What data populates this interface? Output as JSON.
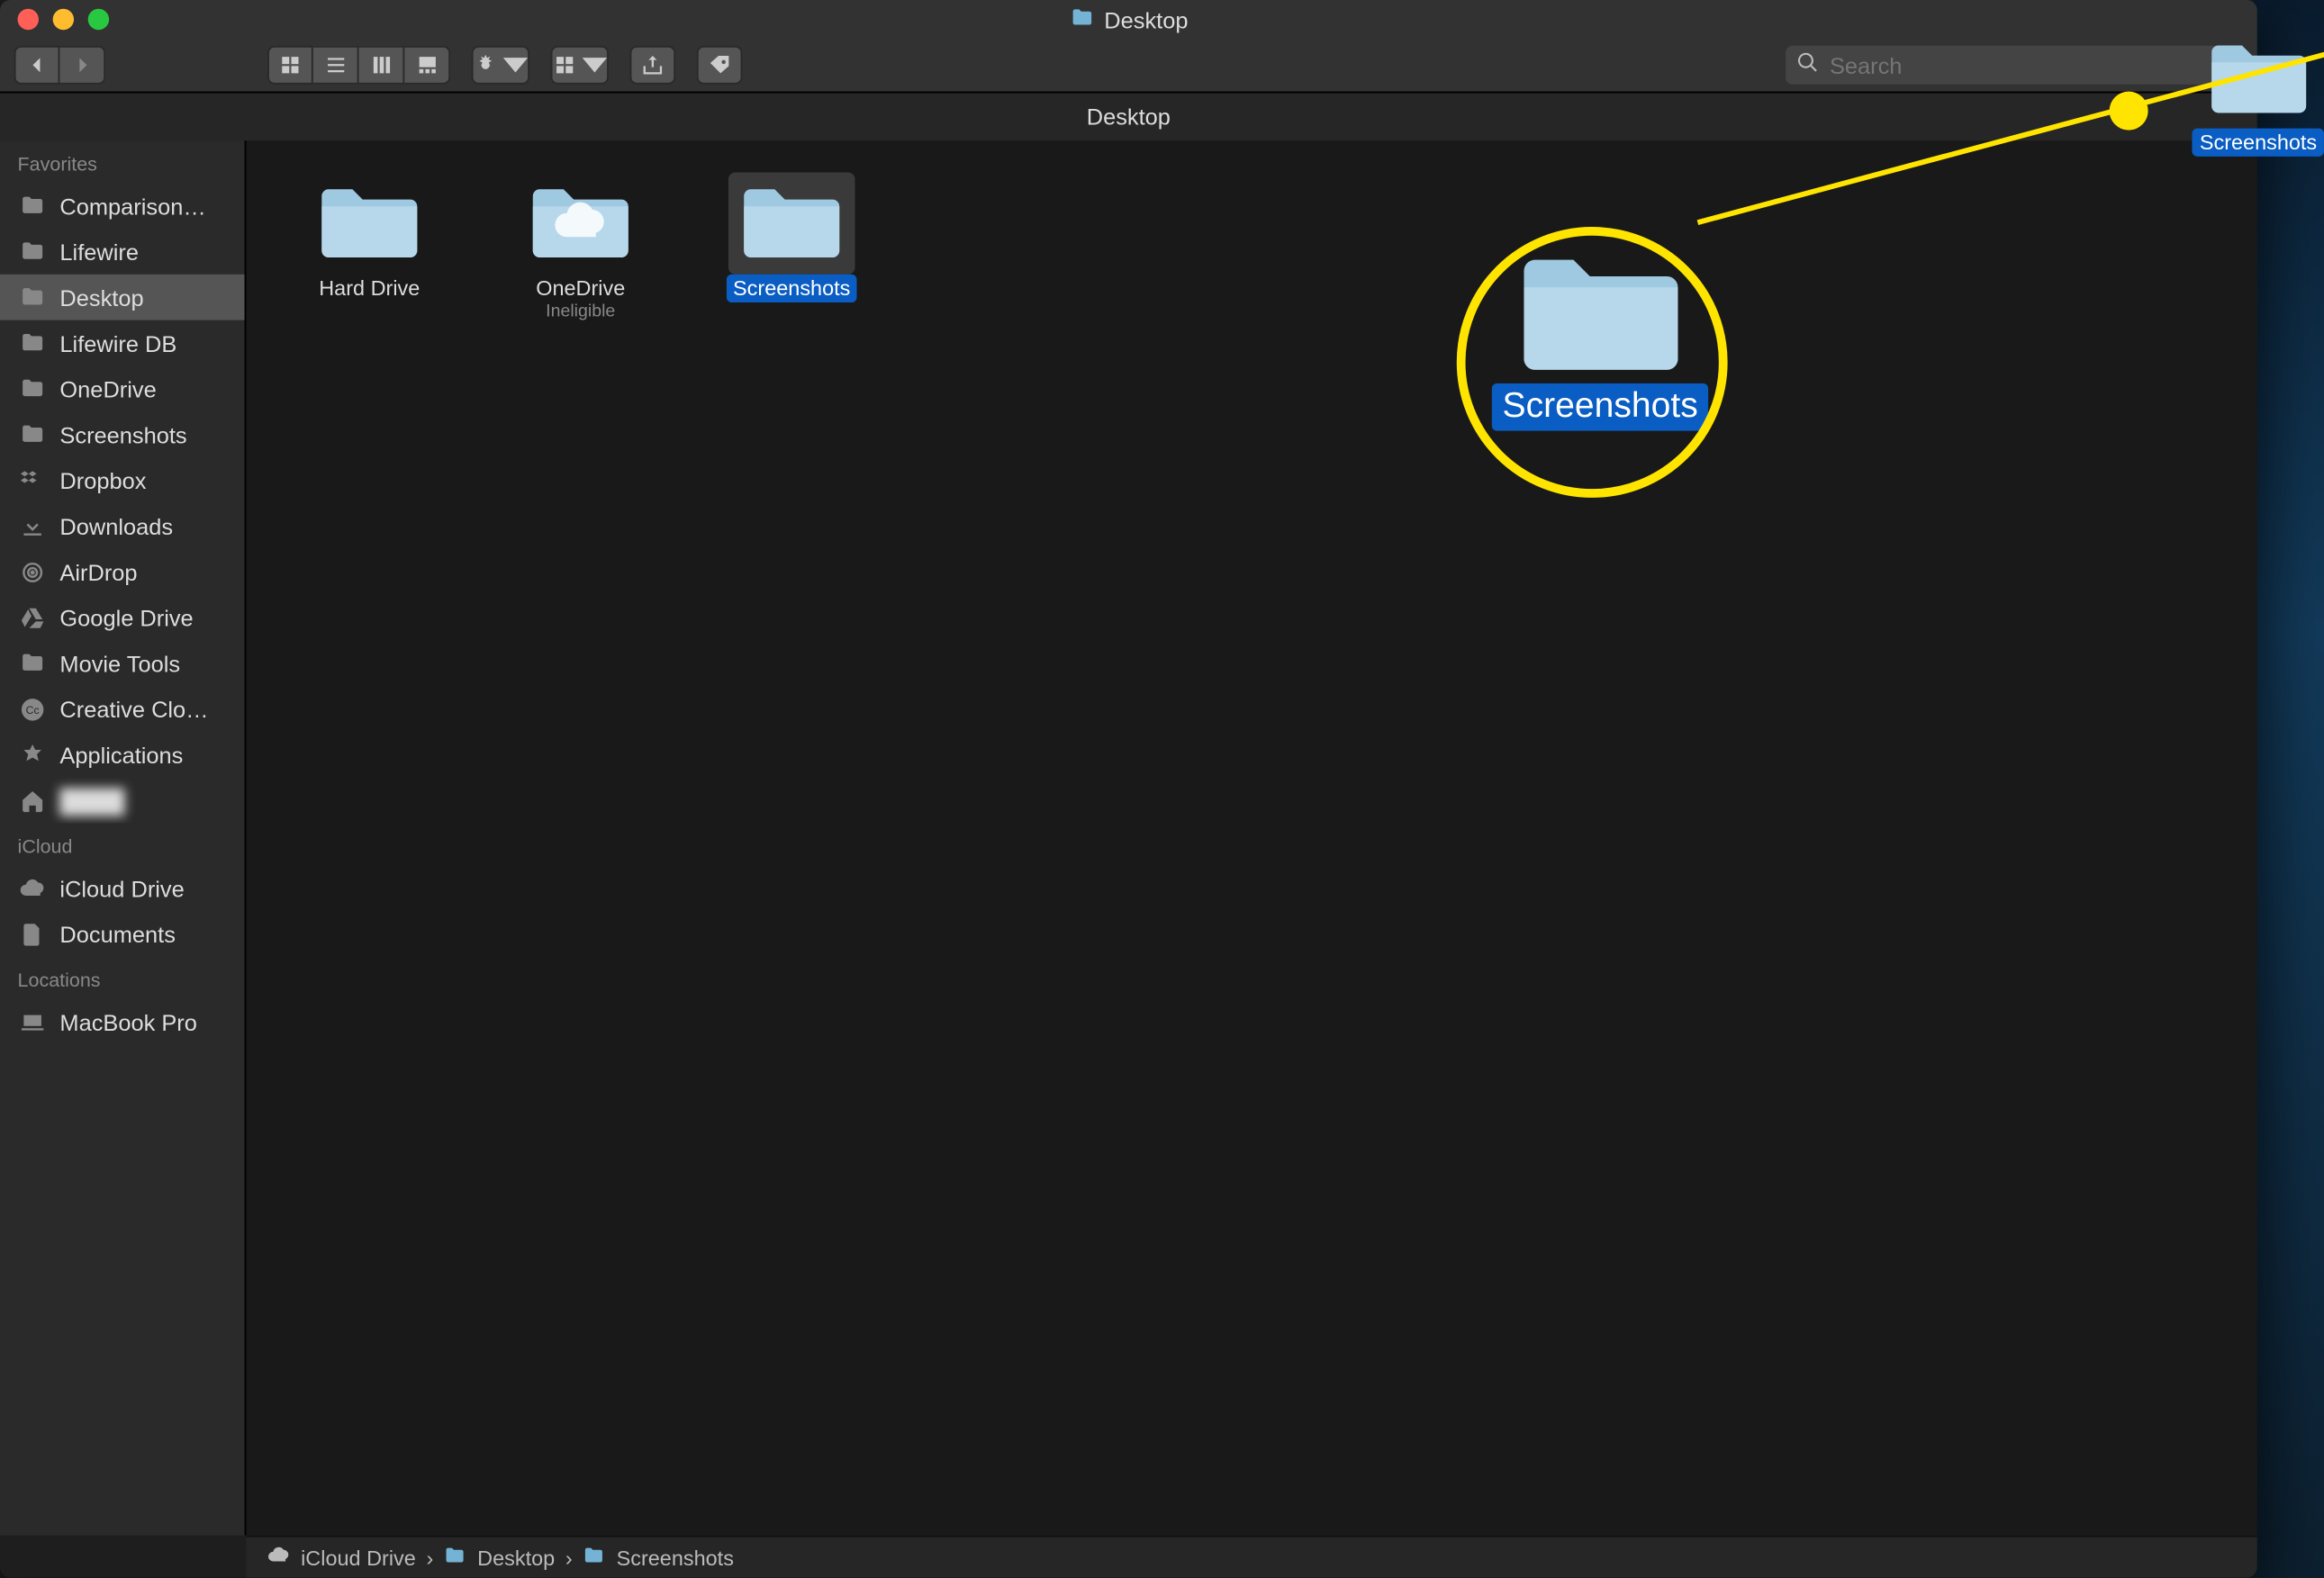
{
  "window": {
    "title": "Desktop"
  },
  "toolbar": {
    "search_placeholder": "Search"
  },
  "current_path_label": "Desktop",
  "sidebar": {
    "sections": [
      {
        "header": "Favorites",
        "items": [
          {
            "label": "Comparison…",
            "icon": "folder"
          },
          {
            "label": "Lifewire",
            "icon": "folder"
          },
          {
            "label": "Desktop",
            "icon": "folder",
            "selected": true
          },
          {
            "label": "Lifewire DB",
            "icon": "folder"
          },
          {
            "label": "OneDrive",
            "icon": "folder"
          },
          {
            "label": "Screenshots",
            "icon": "folder"
          },
          {
            "label": "Dropbox",
            "icon": "dropbox"
          },
          {
            "label": "Downloads",
            "icon": "download"
          },
          {
            "label": "AirDrop",
            "icon": "airdrop"
          },
          {
            "label": "Google Drive",
            "icon": "gdrive"
          },
          {
            "label": "Movie Tools",
            "icon": "folder"
          },
          {
            "label": "Creative Clo…",
            "icon": "cc"
          },
          {
            "label": "Applications",
            "icon": "apps"
          },
          {
            "label": "",
            "icon": "home",
            "blur": true
          }
        ]
      },
      {
        "header": "iCloud",
        "items": [
          {
            "label": "iCloud Drive",
            "icon": "cloud"
          },
          {
            "label": "Documents",
            "icon": "doc"
          }
        ]
      },
      {
        "header": "Locations",
        "items": [
          {
            "label": "MacBook Pro",
            "icon": "laptop"
          }
        ]
      }
    ]
  },
  "content": {
    "items": [
      {
        "label": "Hard Drive",
        "icon": "folder"
      },
      {
        "label": "OneDrive",
        "icon": "cloud-folder",
        "sub": "Ineligible"
      },
      {
        "label": "Screenshots",
        "icon": "folder",
        "selected": true
      }
    ]
  },
  "pathbar": {
    "segments": [
      "iCloud Drive",
      "Desktop",
      "Screenshots"
    ]
  },
  "annotation": {
    "magnified_label": "Screenshots",
    "drag_label": "Screenshots"
  }
}
